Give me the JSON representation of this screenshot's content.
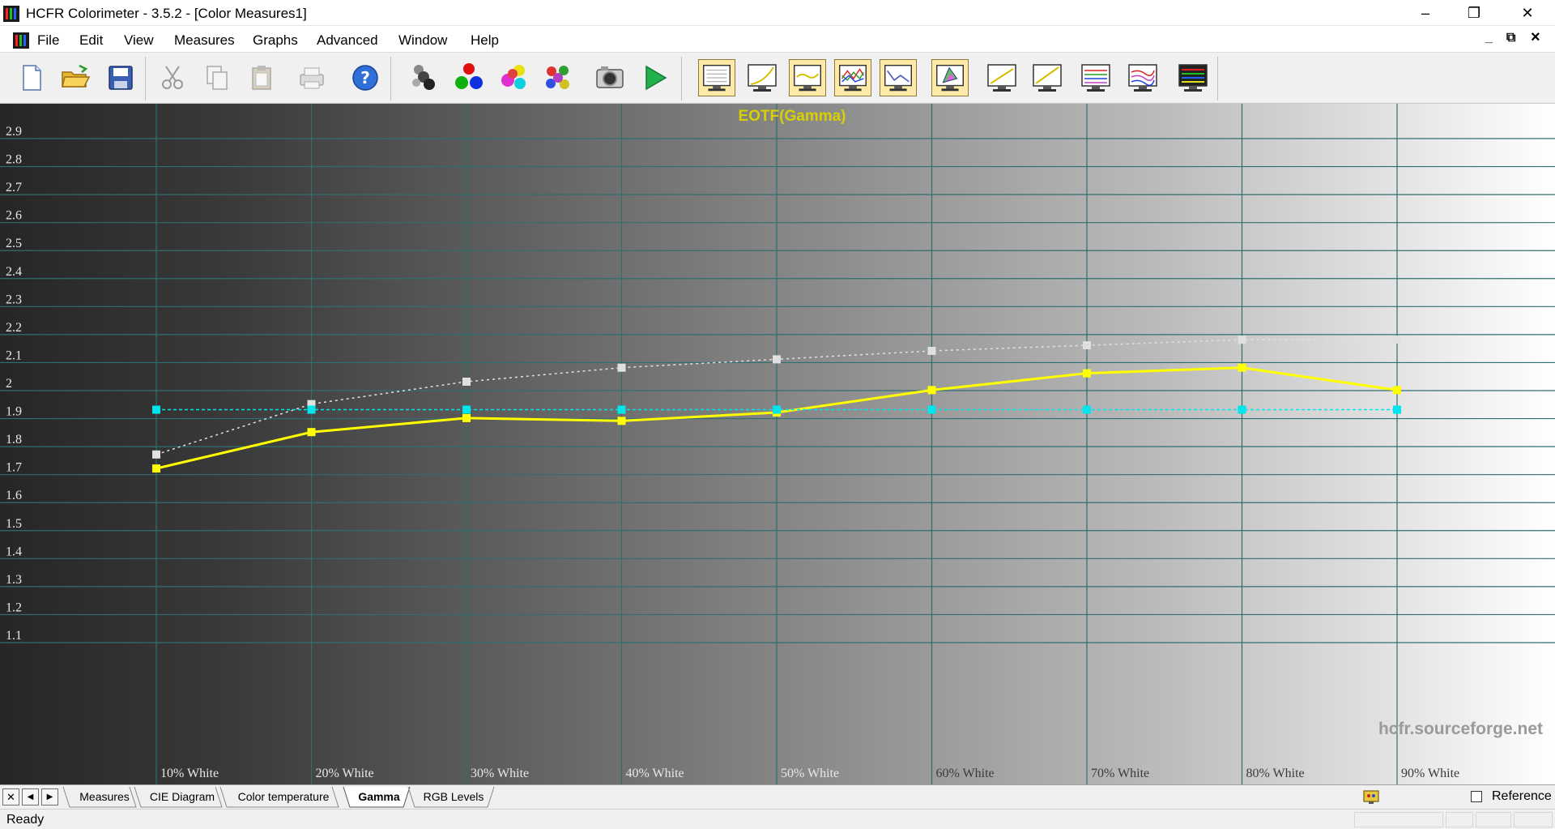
{
  "window": {
    "title": "HCFR Colorimeter - 3.5.2 - [Color Measures1]",
    "minimize": "–",
    "restore": "❐",
    "close": "✕"
  },
  "menu": {
    "items": [
      "File",
      "Edit",
      "View",
      "Measures",
      "Graphs",
      "Advanced",
      "Window",
      "Help"
    ],
    "mdi_minimize": "_",
    "mdi_restore": "⧉",
    "mdi_close": "×"
  },
  "toolbar": {
    "buttons": [
      "new-icon",
      "open-icon",
      "save-icon",
      "cut-icon",
      "copy-icon",
      "paste-icon",
      "print-icon",
      "help-icon",
      "sensor-icon",
      "rgb-primaries-icon",
      "secondary-colors-icon",
      "color-wheel-icon",
      "camera-icon",
      "play-icon",
      "graph-measures-icon",
      "graph-luminance-icon",
      "graph-gamma-icon",
      "graph-rgb-icon",
      "graph-delta-icon",
      "graph-cie-icon",
      "graph-1-icon",
      "graph-2-icon",
      "graph-3-icon",
      "graph-4-icon",
      "graph-5-icon"
    ]
  },
  "chart_data": {
    "type": "line",
    "title": "EOTF(Gamma)",
    "watermark": "hcfr.sourceforge.net",
    "categories": [
      "10% White",
      "20% White",
      "30% White",
      "40% White",
      "50% White",
      "60% White",
      "70% White",
      "80% White",
      "90% White"
    ],
    "ylim": [
      1.05,
      2.98
    ],
    "yticks": [
      1.1,
      1.2,
      1.3,
      1.4,
      1.5,
      1.6,
      1.7,
      1.8,
      1.9,
      2,
      2.1,
      2.2,
      2.3,
      2.4,
      2.5,
      2.6,
      2.7,
      2.8,
      2.9
    ],
    "grid": true,
    "series": [
      {
        "color": "#ffff00",
        "style": "solid",
        "values": [
          1.69,
          1.82,
          1.87,
          1.86,
          1.89,
          1.97,
          2.03,
          2.05,
          1.97
        ]
      },
      {
        "color": "#e0e0e0",
        "style": "dotted",
        "values": [
          1.74,
          1.92,
          2.0,
          2.05,
          2.08,
          2.11,
          2.13,
          2.15,
          2.15
        ]
      },
      {
        "color": "#00e5ee",
        "style": "dashed",
        "values": [
          1.9,
          1.9,
          1.9,
          1.9,
          1.9,
          1.9,
          1.9,
          1.9,
          1.9
        ]
      }
    ]
  },
  "tabs": {
    "items": [
      "Measures",
      "CIE Diagram",
      "Color temperature",
      "Gamma",
      "RGB Levels"
    ],
    "active": "Gamma",
    "nav_close": "✕",
    "nav_prev": "◀",
    "nav_next": "▶"
  },
  "reference_label": "Reference",
  "status": {
    "text": "Ready"
  }
}
